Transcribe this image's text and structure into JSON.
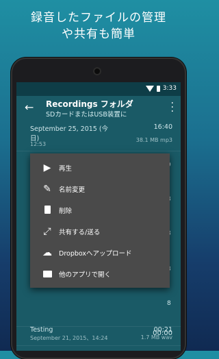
{
  "headline": {
    "line1": "録音したファイルの管理",
    "line2": "や共有も簡単"
  },
  "status": {
    "time": "3:33"
  },
  "appbar": {
    "title": "Recordings フォルダ",
    "subtitle": "SDカードまたはUSB装置に"
  },
  "rows": [
    {
      "name": "September 25, 2015 (今",
      "name2": "日)",
      "date": "12:53",
      "duration": "16:40",
      "meta": "38.1 MB mp3"
    },
    {
      "name": "Testing",
      "date": "September 21, 2015、14:24",
      "duration": "00:21",
      "meta": "1.7 MB wav"
    }
  ],
  "peek": [
    "9",
    "8",
    "8",
    "8",
    "8"
  ],
  "menu": [
    {
      "icon": "play-icon",
      "label": "再生"
    },
    {
      "icon": "pencil-icon",
      "label": "名前変更"
    },
    {
      "icon": "trash-icon",
      "label": "削除"
    },
    {
      "icon": "share-icon",
      "label": "共有する/送る"
    },
    {
      "icon": "cloud-upload-icon",
      "label": "Dropboxへアップロード"
    },
    {
      "icon": "folder-icon",
      "label": "他のアプリで開く"
    }
  ],
  "bottom": {
    "time": "00:00"
  }
}
